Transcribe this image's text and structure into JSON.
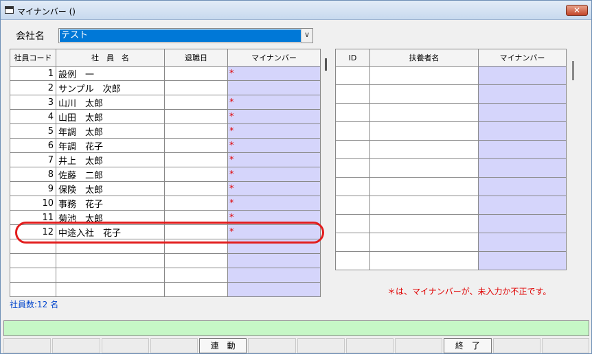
{
  "window": {
    "title": "マイナンバー ()",
    "close": "✕"
  },
  "company": {
    "label": "会社名",
    "value": "テスト",
    "arrow": "∨"
  },
  "employee_table": {
    "headers": [
      "社員コード",
      "社　員　名",
      "退職日",
      "マイナンバー"
    ],
    "rows": [
      {
        "code": "1",
        "name": "設例　一",
        "retire": "",
        "mark": "*"
      },
      {
        "code": "2",
        "name": "サンプル　次郎",
        "retire": "",
        "mark": ""
      },
      {
        "code": "3",
        "name": "山川　太郎",
        "retire": "",
        "mark": "*"
      },
      {
        "code": "4",
        "name": "山田　太郎",
        "retire": "",
        "mark": "*"
      },
      {
        "code": "5",
        "name": "年調　太郎",
        "retire": "",
        "mark": "*"
      },
      {
        "code": "6",
        "name": "年調　花子",
        "retire": "",
        "mark": "*"
      },
      {
        "code": "7",
        "name": "井上　太郎",
        "retire": "",
        "mark": "*"
      },
      {
        "code": "8",
        "name": "佐藤　二郎",
        "retire": "",
        "mark": "*"
      },
      {
        "code": "9",
        "name": "保険　太郎",
        "retire": "",
        "mark": "*"
      },
      {
        "code": "10",
        "name": "事務　花子",
        "retire": "",
        "mark": "*"
      },
      {
        "code": "11",
        "name": "菊池　太郎",
        "retire": "",
        "mark": "*"
      },
      {
        "code": "12",
        "name": "中途入社　花子",
        "retire": "",
        "mark": "*"
      },
      {
        "code": "",
        "name": "",
        "retire": "",
        "mark": ""
      },
      {
        "code": "",
        "name": "",
        "retire": "",
        "mark": ""
      },
      {
        "code": "",
        "name": "",
        "retire": "",
        "mark": ""
      },
      {
        "code": "",
        "name": "",
        "retire": "",
        "mark": ""
      }
    ]
  },
  "dependent_table": {
    "headers": [
      "ID",
      "扶養者名",
      "マイナンバー"
    ],
    "row_count": 11
  },
  "employee_count": "社員数:12 名",
  "note": "＊は、マイナンバーが、未入力か不正です。",
  "function_keys": [
    "",
    "",
    "",
    "",
    "連　動",
    "",
    "",
    "",
    "",
    "終　了",
    "",
    ""
  ],
  "colors": {
    "mynumber_cell": "#d5d5fb",
    "highlight": "#e21c1c",
    "status": "#c6f7c6",
    "selection": "#0078d7"
  }
}
